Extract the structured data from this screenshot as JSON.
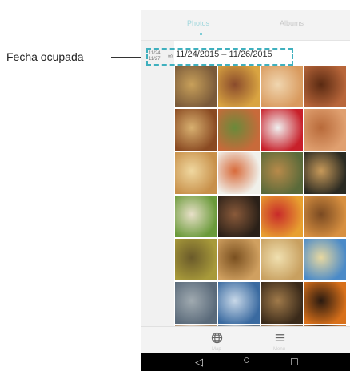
{
  "callout": {
    "label": "Fecha ocupada"
  },
  "tabs": [
    {
      "label": "Photos",
      "active": true
    },
    {
      "label": "Albums",
      "active": false
    }
  ],
  "date_header": {
    "mini_start": "11/24",
    "mini_end": "11/27",
    "icon": "circle-check-icon",
    "range": "11/24/2015 – 11/26/2015"
  },
  "bottom_bar": [
    {
      "icon": "globe-icon",
      "label": "Map"
    },
    {
      "icon": "menu-icon",
      "label": "Menu"
    }
  ],
  "nav": {
    "back": "◁",
    "home": "○",
    "recents": "☐"
  },
  "photos": [
    "tart-collage",
    "cupcakes",
    "donuts",
    "fruit-tart",
    "breads",
    "fruit-skewers",
    "strawberries",
    "sugared-donuts",
    "baguettes",
    "plated-dish",
    "salads-table",
    "dessert-spread",
    "pasta-plate",
    "dark-food",
    "fruit-tower",
    "croissants",
    "soup-bowl",
    "tea-set",
    "sunlit-trees",
    "beach-sky",
    "grey-sea",
    "sea-chair",
    "bicycle",
    "pumpkins",
    "row7-a",
    "row7-b",
    "row7-c",
    "row7-d"
  ],
  "colors": {
    "accent": "#2fb2c2",
    "callout_border": "#3fb0be",
    "tab_inactive": "#c9c9c9",
    "background": "#f3f3f3"
  }
}
